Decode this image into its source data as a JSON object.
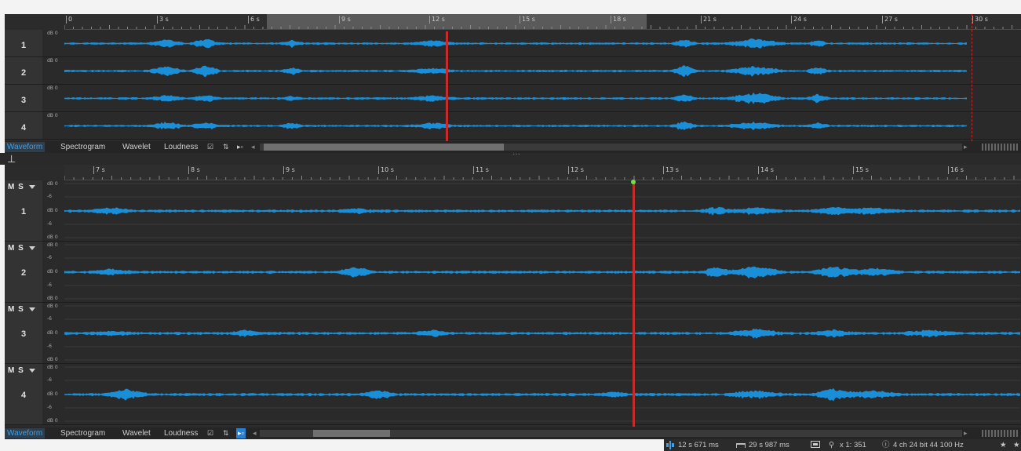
{
  "top_ruler": {
    "labels": [
      "0",
      "3 s",
      "6 s",
      "9 s",
      "12 s",
      "15 s",
      "18 s",
      "21 s",
      "24 s",
      "27 s",
      "30 s"
    ]
  },
  "top_channels": [
    {
      "number": "1",
      "db_label": "dB 0"
    },
    {
      "number": "2",
      "db_label": "dB 0"
    },
    {
      "number": "3",
      "db_label": "dB 0"
    },
    {
      "number": "4",
      "db_label": "dB 0"
    }
  ],
  "view_tabs": {
    "waveform": "Waveform",
    "spectrogram": "Spectrogram",
    "wavelet": "Wavelet",
    "loudness": "Loudness"
  },
  "bottom_ruler": {
    "labels": [
      "7 s",
      "8 s",
      "9 s",
      "10 s",
      "11 s",
      "12 s",
      "13 s",
      "14 s",
      "15 s",
      "16 s"
    ]
  },
  "bottom_channels": [
    {
      "number": "1",
      "ms": "M S"
    },
    {
      "number": "2",
      "ms": "M S"
    },
    {
      "number": "3",
      "ms": "M S"
    },
    {
      "number": "4",
      "ms": "M S"
    }
  ],
  "db_scale": {
    "top": "dB 0",
    "mid_upper": "-6",
    "center": "dB 0",
    "mid_lower": "-6",
    "bottom": "dB 0"
  },
  "status_bar": {
    "cursor_position": "12 s 671 ms",
    "duration": "29 s 987 ms",
    "zoom": "x 1: 351",
    "format": "4 ch 24 bit 44 100 Hz"
  },
  "colors": {
    "waveform": "#1a8fd8",
    "cursor": "#c42b2b",
    "accent": "#3da0e8",
    "background": "#2b2b2b"
  }
}
